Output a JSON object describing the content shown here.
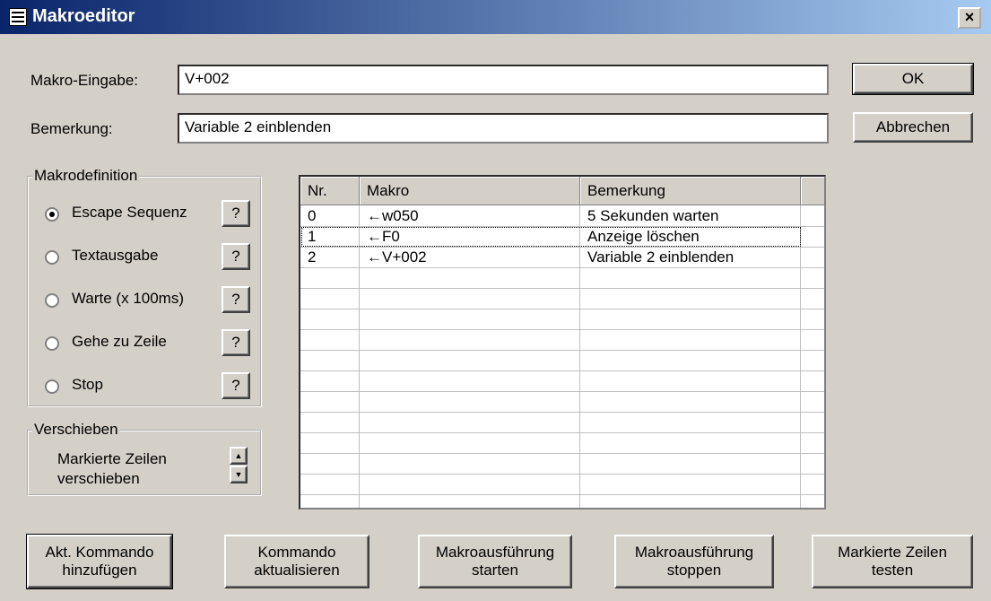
{
  "window": {
    "title": "Makroeditor",
    "close_symbol": "×",
    "icon": "window-menu-icon"
  },
  "macro_input": {
    "label": "Makro-Eingabe:",
    "value": "V+002"
  },
  "remark_input": {
    "label": "Bemerkung:",
    "value": "Variable 2 einblenden"
  },
  "buttons": {
    "ok": "OK",
    "cancel": "Abbrechen"
  },
  "makrodefinition": {
    "legend": "Makrodefinition",
    "help_label": "?",
    "options": [
      {
        "label": "Escape Sequenz",
        "checked": true
      },
      {
        "label": "Textausgabe",
        "checked": false
      },
      {
        "label": "Warte (x 100ms)",
        "checked": false
      },
      {
        "label": "Gehe zu Zeile",
        "checked": false
      },
      {
        "label": "Stop",
        "checked": false
      }
    ]
  },
  "verschieben": {
    "legend": "Verschieben",
    "text_line1": "Markierte Zeilen",
    "text_line2": "verschieben",
    "up_icon": "arrow-up-icon",
    "down_icon": "arrow-down-icon"
  },
  "table": {
    "columns": [
      "Nr.",
      "Makro",
      "Bemerkung"
    ],
    "rows": [
      {
        "nr": "0",
        "makro": "←w050",
        "bemerkung": "5 Sekunden warten"
      },
      {
        "nr": "1",
        "makro": "←F0",
        "bemerkung": "Anzeige löschen"
      },
      {
        "nr": "2",
        "makro": "←V+002",
        "bemerkung": "Variable 2 einblenden"
      }
    ],
    "focused_row": 1
  },
  "bottom_buttons": [
    {
      "line1": "Akt. Kommando",
      "line2": "hinzufügen"
    },
    {
      "line1": "Kommando",
      "line2": "aktualisieren"
    },
    {
      "line1": "Makroausführung",
      "line2": "starten"
    },
    {
      "line1": "Makroausführung",
      "line2": "stoppen"
    },
    {
      "line1": "Markierte Zeilen",
      "line2": "testen"
    }
  ]
}
